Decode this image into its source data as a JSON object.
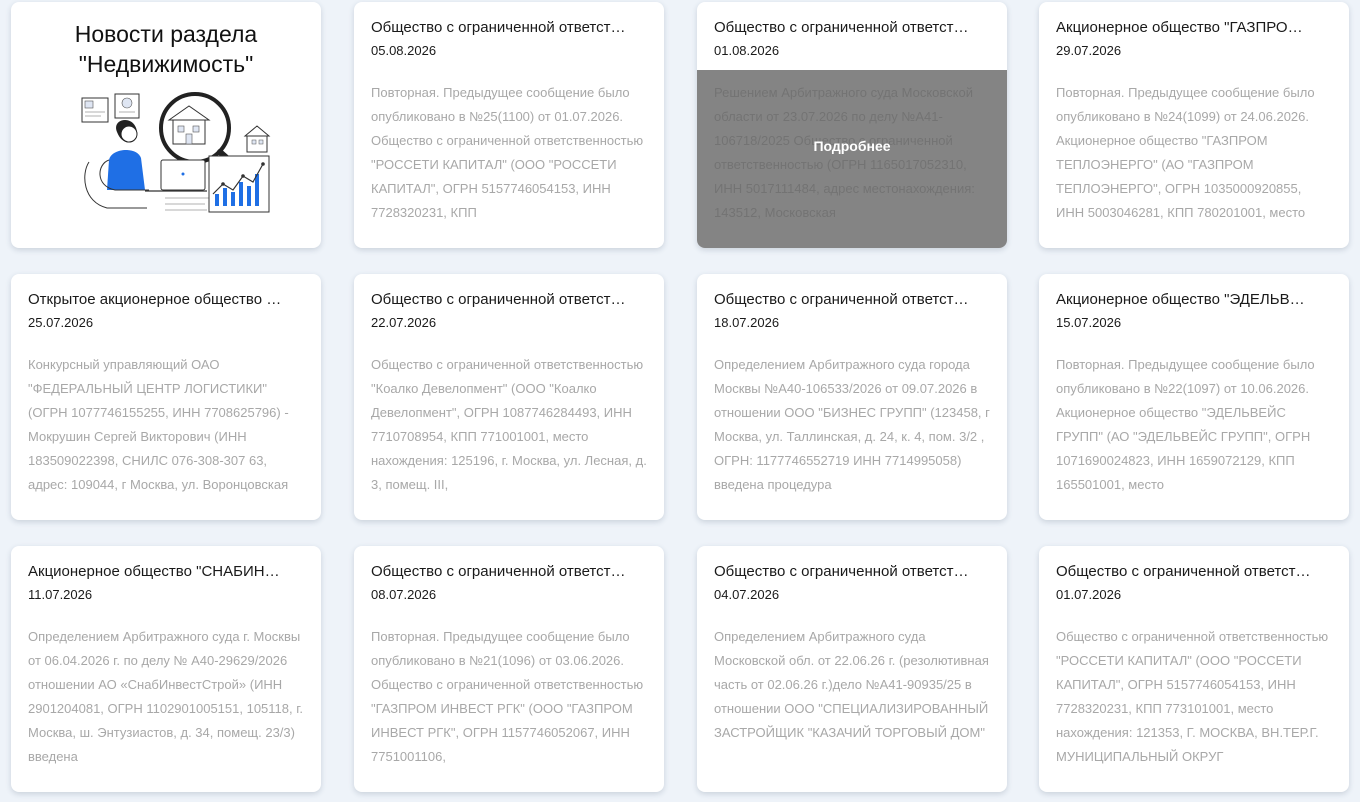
{
  "section": {
    "title_line1": "Новости раздела",
    "title_line2": "\"Недвижимость\"",
    "illustration": "real-estate-search-illustration"
  },
  "hover_label": "Подробнее",
  "cards": [
    {
      "title": "Общество с ограниченной ответст…",
      "date": "05.08.2026",
      "text": "Повторная. Предыдущее сообщение было опубликовано в №25(1100) от 01.07.2026. Общество с ограниченной ответственностью \"РОССЕТИ КАПИТАЛ\" (ООО \"РОССЕТИ КАПИТАЛ\", ОГРН 5157746054153, ИНН 7728320231, КПП"
    },
    {
      "title": "Общество с ограниченной ответст…",
      "date": "01.08.2026",
      "text": "Решением Арбитражного суда Московской области от 23.07.2026 по делу №А41-106718/2025 Общество с ограниченной ответственностью (ОГРН 1165017052310, ИНН 5017111484, адрес местонахождения: 143512, Московская",
      "hovered": true
    },
    {
      "title": "Акционерное общество \"ГАЗПРО…",
      "date": "29.07.2026",
      "text": "Повторная. Предыдущее сообщение было опубликовано в №24(1099) от 24.06.2026. Акционерное общество \"ГАЗПРОМ ТЕПЛОЭНЕРГО\" (АО \"ГАЗПРОМ ТЕПЛОЭНЕРГО\", ОГРН 1035000920855, ИНН 5003046281, КПП 780201001, место"
    },
    {
      "title": "Открытое акционерное общество …",
      "date": "25.07.2026",
      "text": "Конкурсный управляющий ОАО \"ФЕДЕРАЛЬНЫЙ ЦЕНТР ЛОГИСТИКИ\" (ОГРН 1077746155255, ИНН 7708625796) - Мокрушин Сергей Викторович (ИНН 183509022398, СНИЛС 076-308-307 63, адрес: 109044, г Москва, ул. Воронцовская"
    },
    {
      "title": "Общество с ограниченной ответст…",
      "date": "22.07.2026",
      "text": "Общество с ограниченной ответственностью \"Коалко Девелопмент\" (ООО \"Коалко Девелопмент\", ОГРН 1087746284493, ИНН 7710708954, КПП 771001001, место нахождения: 125196, г. Москва, ул. Лесная, д. 3, помещ. III,"
    },
    {
      "title": "Общество с ограниченной ответст…",
      "date": "18.07.2026",
      "text": "Определением Арбитражного суда города Москвы №А40-106533/2026 от 09.07.2026 в отношении ООО \"БИЗНЕС ГРУПП\" (123458, г Москва, ул. Таллинская, д. 24, к. 4, пом. 3/2 , ОГРН: 1177746552719 ИНН 7714995058) введена процедура"
    },
    {
      "title": "Акционерное общество \"ЭДЕЛЬВ…",
      "date": "15.07.2026",
      "text": "Повторная. Предыдущее сообщение было опубликовано в №22(1097) от 10.06.2026. Акционерное общество \"ЭДЕЛЬВЕЙС ГРУПП\" (АО \"ЭДЕЛЬВЕЙС ГРУПП\", ОГРН 1071690024823, ИНН 1659072129, КПП 165501001, место"
    },
    {
      "title": "Акционерное общество \"СНАБИН…",
      "date": "11.07.2026",
      "text": "Определением Арбитражного суда г. Москвы от 06.04.2026 г. по делу № А40-29629/2026 отношении АО «СнабИнвестСтрой» (ИНН 2901204081, ОГРН 1102901005151, 105118, г. Москва, ш. Энтузиастов, д. 34, помещ. 23/3) введена"
    },
    {
      "title": "Общество с ограниченной ответст…",
      "date": "08.07.2026",
      "text": "Повторная. Предыдущее сообщение было опубликовано в №21(1096) от 03.06.2026. Общество с ограниченной ответственностью \"ГАЗПРОМ ИНВЕСТ РГК\" (ООО \"ГАЗПРОМ ИНВЕСТ РГК\", ОГРН 1157746052067, ИНН 7751001106,"
    },
    {
      "title": "Общество с ограниченной ответст…",
      "date": "04.07.2026",
      "text": "Определением Арбитражного суда Московской обл. от 22.06.26 г. (резолютивная часть от 02.06.26 г.)дело №А41-90935/25 в отношении ООО \"СПЕЦИАЛИЗИРОВАННЫЙ ЗАСТРОЙЩИК \"КАЗАЧИЙ ТОРГОВЫЙ ДОМ\""
    },
    {
      "title": "Общество с ограниченной ответст…",
      "date": "01.07.2026",
      "text": "Общество с ограниченной ответственностью \"РОССЕТИ КАПИТАЛ\" (ООО \"РОССЕТИ КАПИТАЛ\", ОГРН 5157746054153, ИНН 7728320231, КПП 773101001, место нахождения: 121353, Г. МОСКВА, ВН.ТЕР.Г. МУНИЦИПАЛЬНЫЙ ОКРУГ"
    }
  ]
}
